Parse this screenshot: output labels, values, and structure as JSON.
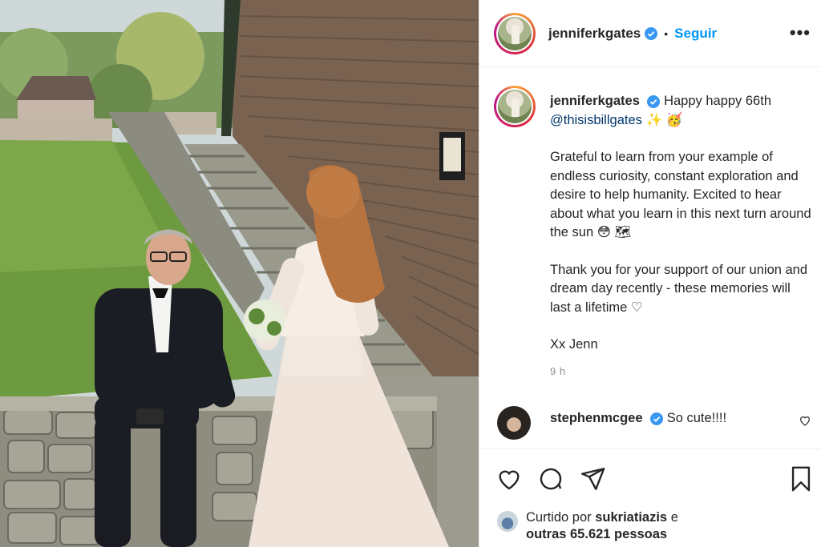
{
  "post": {
    "photo_alt": "Bill Gates and Jennifer Gates wedding photo",
    "header": {
      "username": "jenniferkgates",
      "separator": "•",
      "follow_label": "Seguir",
      "more_icon": "more-options-icon"
    },
    "caption": {
      "username": "jenniferkgates",
      "line_intro": "Happy happy 66th",
      "mention": "@thisisbillgates",
      "emojis_first": "✨ 🥳",
      "para2": "Grateful to learn from your example of endless curiosity, constant exploration and desire to help humanity. Excited to hear about what you learn in this next turn around the sun 😳 🗺",
      "para3": "Thank you for your support of our union and dream day recently - these memories will last a lifetime ♡",
      "signoff": "Xx Jenn",
      "time": "9 h"
    },
    "comment": {
      "username": "stephenmcgee",
      "text": "So cute!!!!"
    },
    "likes": {
      "prefix": "Curtido por",
      "user": "sukriatiazis",
      "conjunction": "e",
      "others": "outras 65.621 pessoas"
    },
    "colors": {
      "accent": "#0095f6",
      "text": "#262626",
      "muted": "#8e8e8e",
      "border": "#efefef"
    }
  }
}
